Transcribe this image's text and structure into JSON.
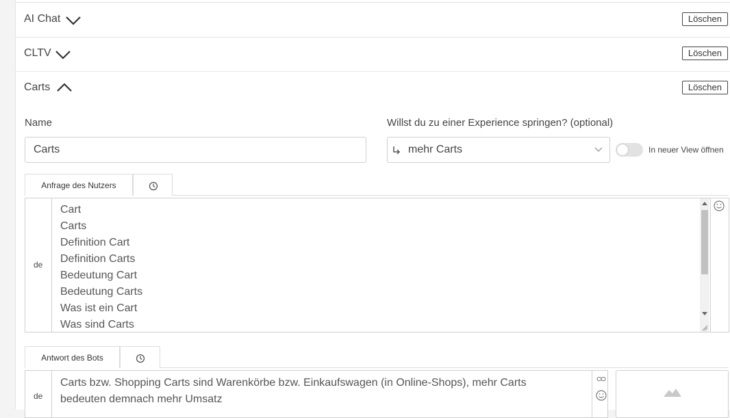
{
  "sections": [
    {
      "title": "AI Chat",
      "expanded": false,
      "delete_label": "Löschen"
    },
    {
      "title": "CLTV",
      "expanded": false,
      "delete_label": "Löschen"
    },
    {
      "title": "Carts",
      "expanded": true,
      "delete_label": "Löschen"
    }
  ],
  "form": {
    "name_label": "Name",
    "name_value": "Carts",
    "jump_label": "Willst du zu einer Experience springen? (optional)",
    "jump_value": "mehr Carts",
    "toggle_label": "In neuer View öffnen",
    "toggle_on": false
  },
  "user_query": {
    "tab_label": "Anfrage des Nutzers",
    "lang": "de",
    "utterances": [
      "Cart",
      "Carts",
      "Definition Cart",
      "Definition Carts",
      "Bedeutung Cart",
      "Bedeutung Carts",
      "Was ist ein Cart",
      "Was sind Carts"
    ]
  },
  "bot_answer": {
    "tab_label": "Antwort des Bots",
    "lang": "de",
    "lines": [
      "Carts bzw. Shopping Carts sind Warenkörbe bzw. Einkaufswagen (in Online-Shops), mehr Carts",
      "bedeuten demnach mehr Umsatz"
    ]
  },
  "icons": {
    "history": "clock-icon",
    "emoji": "smiley-icon",
    "link": "link-icon",
    "image_placeholder": "mountain-image-icon",
    "arrow": "return-arrow-icon"
  },
  "colors": {
    "border": "#cfcfcf",
    "text": "#444444",
    "toggle_off": "#e2e2e2"
  }
}
